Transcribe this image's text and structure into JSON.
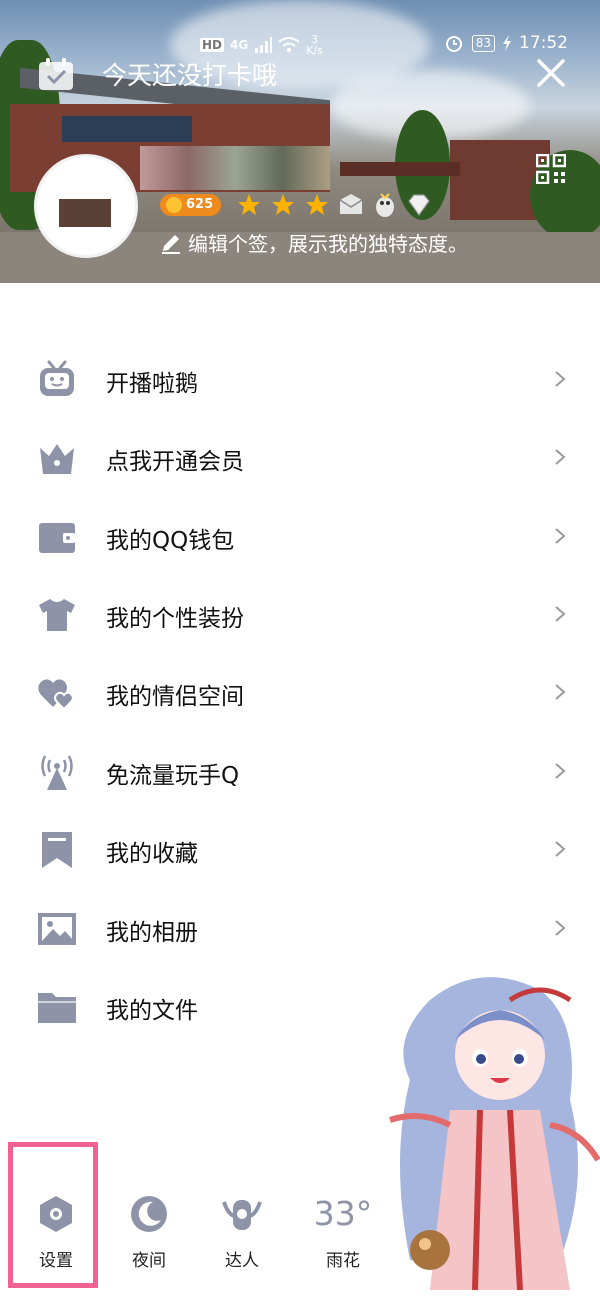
{
  "status_bar": {
    "hd": "HD",
    "network": "4G",
    "speed_value": "3",
    "speed_unit": "K/s",
    "battery": "83",
    "time": "17:52"
  },
  "header": {
    "checkin_text": "今天还没打卡哦",
    "level_value": "625",
    "signature": "编辑个签，展示我的独特态度。"
  },
  "menu": [
    {
      "label": "开播啦鹅",
      "icon": "tv-robot-icon"
    },
    {
      "label": "点我开通会员",
      "icon": "crown-icon"
    },
    {
      "label": "我的QQ钱包",
      "icon": "wallet-icon"
    },
    {
      "label": "我的个性装扮",
      "icon": "tshirt-icon"
    },
    {
      "label": "我的情侣空间",
      "icon": "hearts-icon"
    },
    {
      "label": "免流量玩手Q",
      "icon": "signal-tower-icon"
    },
    {
      "label": "我的收藏",
      "icon": "bookmark-icon"
    },
    {
      "label": "我的相册",
      "icon": "photo-icon"
    },
    {
      "label": "我的文件",
      "icon": "folder-icon"
    }
  ],
  "bottom_bar": {
    "settings_label": "设置",
    "night_label": "夜间",
    "expert_label": "达人",
    "weather_temp": "33°",
    "weather_city": "雨花"
  },
  "colors": {
    "icon_gray": "#8e93a8",
    "highlight": "#f06292",
    "level_orange": "#ef8a1c"
  }
}
